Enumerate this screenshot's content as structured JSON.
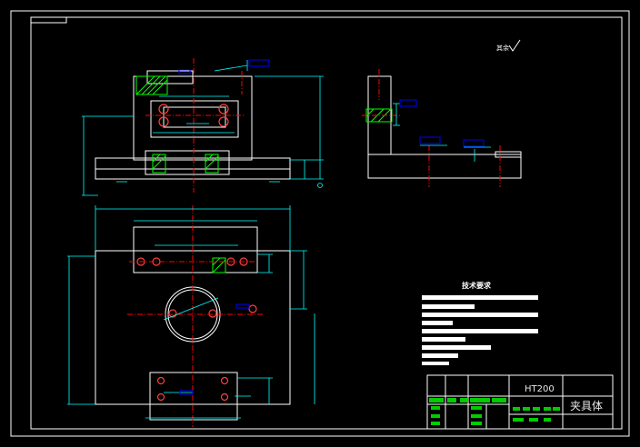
{
  "drawing": {
    "title_block": {
      "material": "HT200",
      "part_name": "夹具体"
    },
    "technical_requirements": {
      "title": "技术要求"
    },
    "roughness_note": "其余"
  },
  "colors": {
    "background": "#000000",
    "outline": "#ffffff",
    "dimension": "#00ffff",
    "centerline": "#ff0000",
    "hatch": "#00ff00",
    "annotation_box": "#0000ff"
  }
}
